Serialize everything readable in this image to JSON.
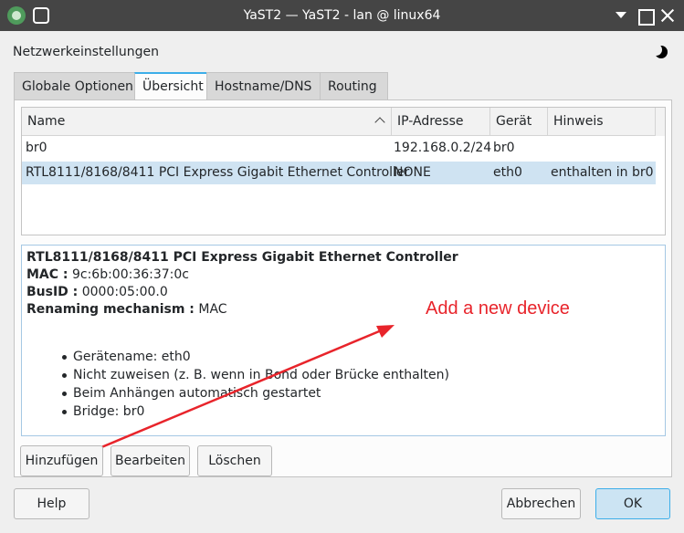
{
  "window": {
    "title": "YaST2 — YaST2 - lan @ linux64",
    "icons": [
      "yast-app-icon",
      "pin-icon",
      "minimize-icon",
      "maximize-icon",
      "close-icon"
    ]
  },
  "heading": "Netzwerkeinstellungen",
  "tabs": [
    {
      "label": "Globale Optionen",
      "active": false
    },
    {
      "label": "Übersicht",
      "active": true
    },
    {
      "label": "Hostname/DNS",
      "active": false
    },
    {
      "label": "Routing",
      "active": false
    }
  ],
  "table": {
    "columns": [
      "Name",
      "IP-Adresse",
      "Gerät",
      "Hinweis"
    ],
    "rows": [
      {
        "name": "br0",
        "ip": "192.168.0.2/24",
        "device": "br0",
        "note": "",
        "selected": false
      },
      {
        "name": "RTL8111/8168/8411 PCI Express Gigabit Ethernet Controller",
        "ip": "NONE",
        "device": "eth0",
        "note": "enthalten in br0",
        "selected": true
      }
    ]
  },
  "details": {
    "title": "RTL8111/8168/8411 PCI Express Gigabit Ethernet Controller",
    "mac_label": "MAC :",
    "mac_value": "9c:6b:00:36:37:0c",
    "busid_label": "BusID :",
    "busid_value": "0000:05:00.0",
    "renaming_label": "Renaming mechanism :",
    "renaming_value": "MAC",
    "bullets": [
      "Gerätename: eth0",
      "Nicht zuweisen (z. B. wenn in Bond oder Brücke enthalten)",
      "Beim Anhängen automatisch gestartet",
      "Bridge: br0"
    ]
  },
  "annotation": {
    "text": "Add a new device",
    "color": "#e8242b"
  },
  "buttons": {
    "add": "Hinzufügen",
    "edit": "Bearbeiten",
    "delete": "Löschen",
    "help": "Help",
    "cancel": "Abbrechen",
    "ok": "OK"
  },
  "colors": {
    "accent": "#3daee9",
    "selection": "#cfe3f2",
    "titlebar": "#454545"
  }
}
